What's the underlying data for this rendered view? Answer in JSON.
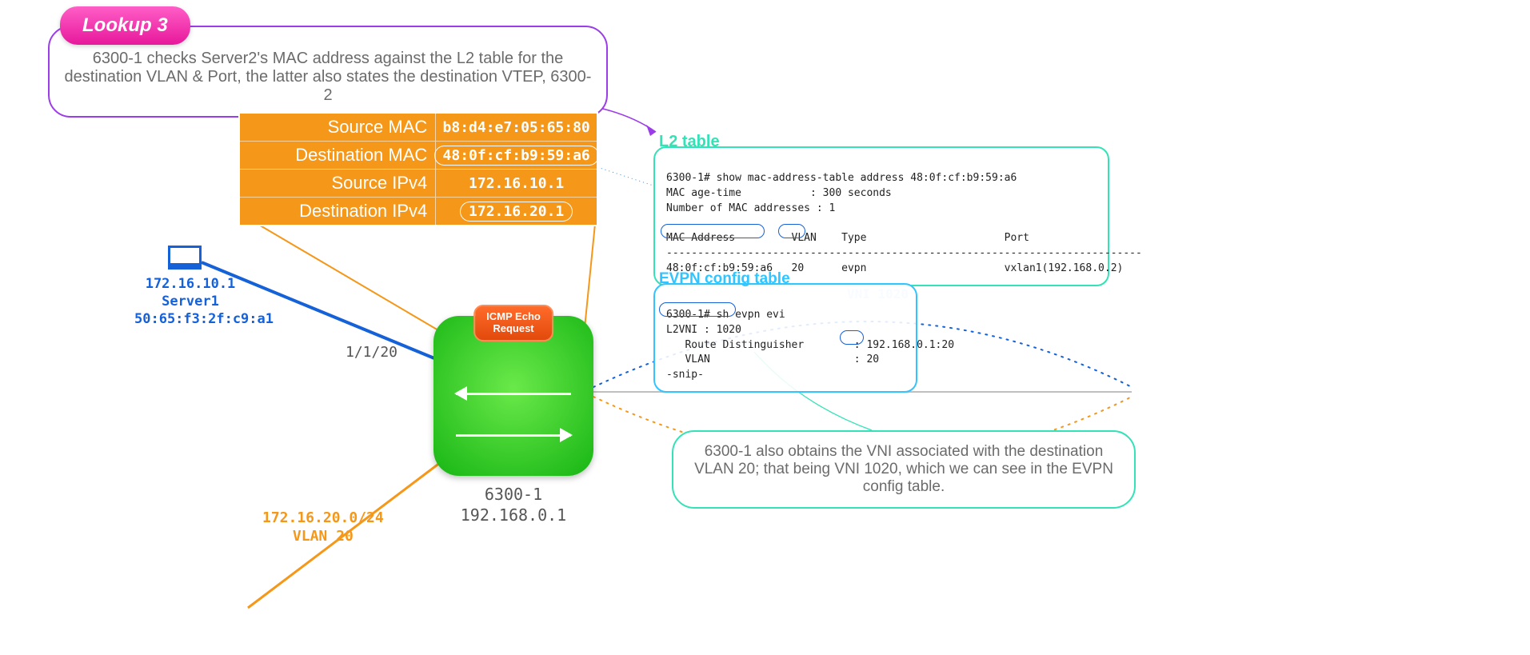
{
  "lookup": {
    "badge": "Lookup 3",
    "text": "6300-1 checks Server2's MAC address against the L2 table for the destination VLAN & Port, the latter also states the destination VTEP, 6300-2"
  },
  "packet": {
    "rows": [
      {
        "k": "Source MAC",
        "v": "b8:d4:e7:05:65:80",
        "pill": false
      },
      {
        "k": "Destination MAC",
        "v": "48:0f:cf:b9:59:a6",
        "pill": true
      },
      {
        "k": "Source IPv4",
        "v": "172.16.10.1",
        "pill": false
      },
      {
        "k": "Destination IPv4",
        "v": "172.16.20.1",
        "pill": true
      }
    ]
  },
  "server1": {
    "ip": "172.16.10.1",
    "name": "Server1",
    "mac": "50:65:f3:2f:c9:a1"
  },
  "port_label": "1/1/20",
  "icmp": {
    "l1": "ICMP Echo",
    "l2": "Request"
  },
  "switch": {
    "name": "6300-1",
    "ip": "192.168.0.1"
  },
  "vlan20": {
    "subnet": "172.16.20.0/24",
    "name": "VLAN 20"
  },
  "l2table": {
    "title": "L2 table",
    "cmd": "6300-1# show mac-address-table address 48:0f:cf:b9:59:a6",
    "age": "MAC age-time           : 300 seconds",
    "count": "Number of MAC addresses : 1",
    "hdr": "MAC Address         VLAN    Type                      Port",
    "sep": "----------------------------------------------------------------------------",
    "row": "48:0f:cf:b9:59:a6   20      evpn                      vxlan1(192.168.0.2)"
  },
  "evpn": {
    "title": "EVPN config table",
    "cmd": "6300-1# sh evpn evi",
    "l2vni": "L2VNI : 1020",
    "rd": "   Route Distinguisher        : 192.168.0.1:20",
    "vlan": "   VLAN                       : 20",
    "snip": "-snip-"
  },
  "vni_ghost": "VNI 1020",
  "vni_note": "6300-1 also obtains the VNI associated with the destination VLAN 20; that being VNI 1020, which we can see in the EVPN config table."
}
